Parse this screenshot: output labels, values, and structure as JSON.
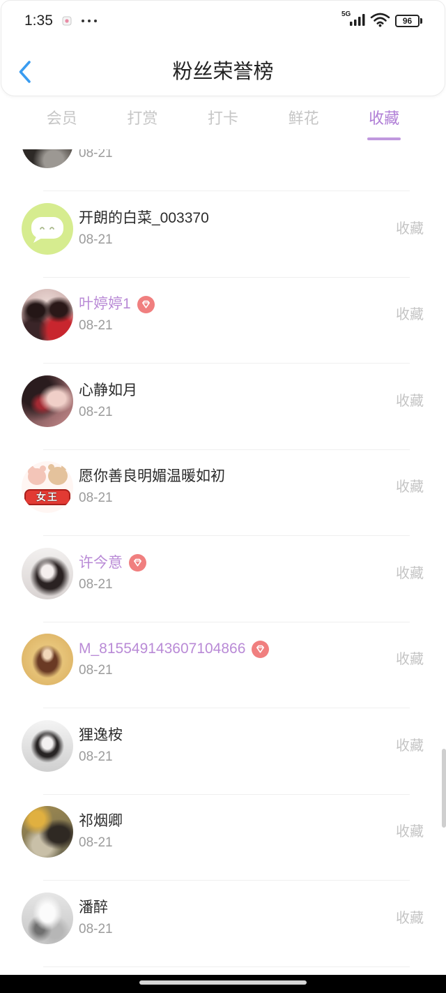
{
  "status_bar": {
    "time": "1:35",
    "network_label": "5G",
    "battery_level": "96"
  },
  "header": {
    "title": "粉丝荣誉榜"
  },
  "tabs": [
    {
      "label": "会员",
      "active": false
    },
    {
      "label": "打赏",
      "active": false
    },
    {
      "label": "打卡",
      "active": false
    },
    {
      "label": "鲜花",
      "active": false
    },
    {
      "label": "收藏",
      "active": true
    }
  ],
  "fans": [
    {
      "date": "08-21",
      "vip": false
    },
    {
      "name": "开朗的白菜_003370",
      "date": "08-21",
      "action": "收藏",
      "vip": false,
      "avatar_icon": "chat-bubble-icon"
    },
    {
      "name": "叶婷婷1",
      "date": "08-21",
      "action": "收藏",
      "vip": true
    },
    {
      "name": "心静如月",
      "date": "08-21",
      "action": "收藏",
      "vip": false
    },
    {
      "name": "愿你善良明媚温暖如初",
      "date": "08-21",
      "action": "收藏",
      "vip": false,
      "avatar_text": "女王"
    },
    {
      "name": "许今意",
      "date": "08-21",
      "action": "收藏",
      "vip": true
    },
    {
      "name": "M_815549143607104866",
      "date": "08-21",
      "action": "收藏",
      "vip": true
    },
    {
      "name": "狸逸桉",
      "date": "08-21",
      "action": "收藏",
      "vip": false
    },
    {
      "name": "祁烟卿",
      "date": "08-21",
      "action": "收藏",
      "vip": false
    },
    {
      "name": "潘醉",
      "date": "08-21",
      "action": "收藏",
      "vip": false
    }
  ],
  "colors": {
    "accent": "#b07ed6",
    "vip_name": "#b98ad6",
    "back_icon": "#3a9cf0",
    "badge": "#f07f7f",
    "tab_inactive": "#c6c6c6",
    "date_text": "#9b9b9b",
    "action_text": "#c4c4c4"
  }
}
